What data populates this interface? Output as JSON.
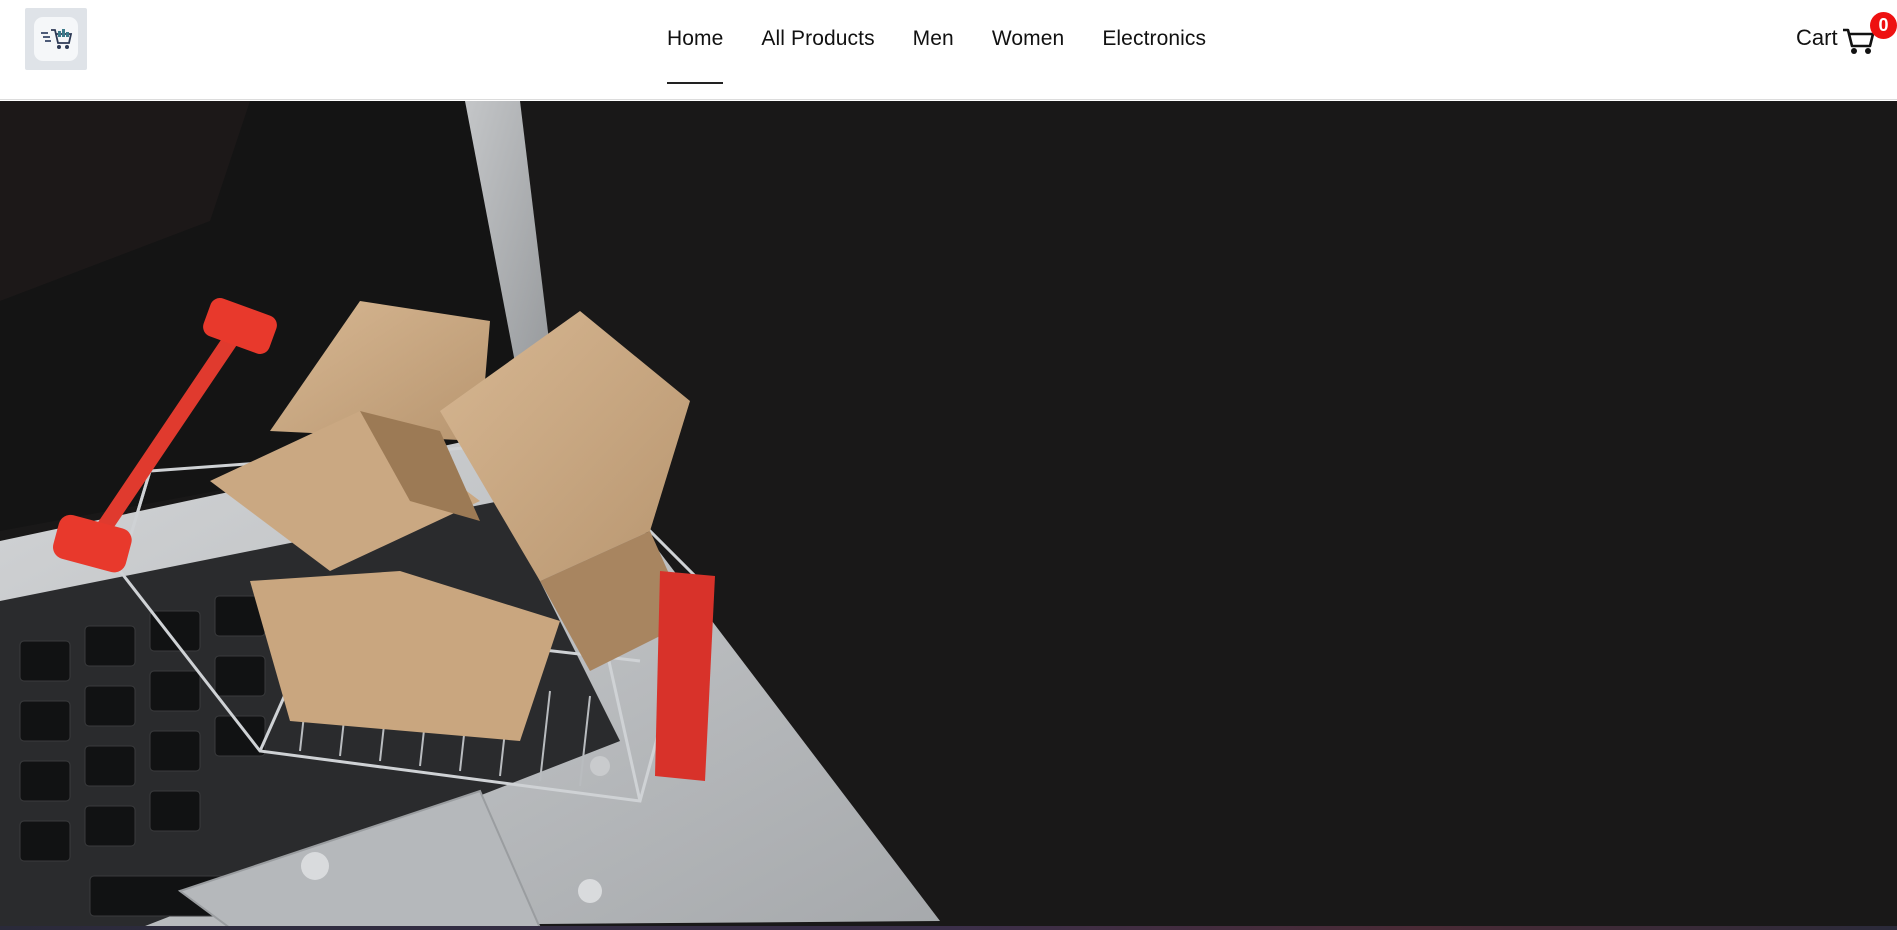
{
  "header": {
    "logo_icon": "shopping-cart-logo-icon",
    "nav": [
      {
        "label": "Home",
        "active": true
      },
      {
        "label": "All Products",
        "active": false
      },
      {
        "label": "Men",
        "active": false
      },
      {
        "label": "Women",
        "active": false
      },
      {
        "label": "Electronics",
        "active": false
      }
    ],
    "cart": {
      "label": "Cart",
      "count": "0",
      "icon": "cart-icon"
    }
  },
  "hero": {
    "image": "shopping-cart-with-boxes-on-laptop-photo"
  },
  "colors": {
    "badge": "#ee1111",
    "hero_background": "#191818",
    "nav_text": "#111111"
  }
}
